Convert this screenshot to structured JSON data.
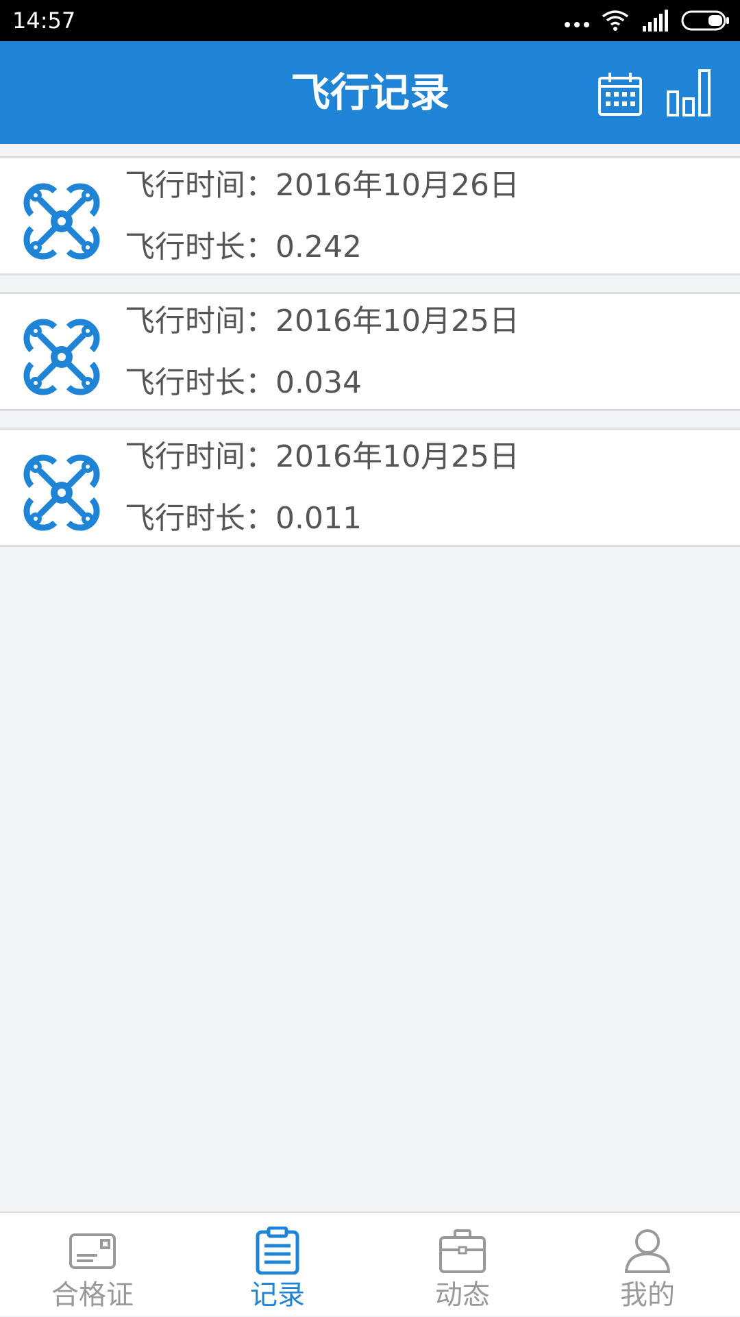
{
  "status_bar": {
    "time": "14:57",
    "icons": [
      "more-dots-icon",
      "wifi-icon",
      "signal-icon",
      "battery-icon"
    ]
  },
  "header": {
    "title": "飞行记录",
    "actions": [
      "calendar-icon",
      "bar-chart-icon"
    ]
  },
  "records": [
    {
      "time_label": "飞行时间：",
      "time_value": "2016年10月26日",
      "duration_label": "飞行时长：",
      "duration_value": "0.242",
      "icon": "drone-icon"
    },
    {
      "time_label": "飞行时间：",
      "time_value": "2016年10月25日",
      "duration_label": "飞行时长：",
      "duration_value": "0.034",
      "icon": "drone-icon"
    },
    {
      "time_label": "飞行时间：",
      "time_value": "2016年10月25日",
      "duration_label": "飞行时长：",
      "duration_value": "0.011",
      "icon": "drone-icon"
    }
  ],
  "bottom_nav": {
    "items": [
      {
        "label": "合格证",
        "icon": "certificate-card-icon",
        "active": false
      },
      {
        "label": "记录",
        "icon": "clipboard-list-icon",
        "active": true
      },
      {
        "label": "动态",
        "icon": "briefcase-icon",
        "active": false
      },
      {
        "label": "我的",
        "icon": "user-icon",
        "active": false
      }
    ]
  },
  "colors": {
    "primary": "#1f84d6",
    "inactive": "#999999",
    "text": "#555555",
    "background": "#f3f4f6"
  }
}
